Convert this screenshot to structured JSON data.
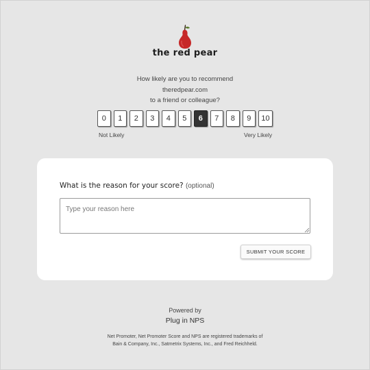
{
  "brand": {
    "logo_icon": "pear-icon",
    "name": "the red pear",
    "logo_color": "#c62828"
  },
  "survey": {
    "question_lines": [
      "How likely are you to recommend",
      "theredpear.com",
      "to a friend or colleague?"
    ],
    "scores": [
      "0",
      "1",
      "2",
      "3",
      "4",
      "5",
      "6",
      "7",
      "8",
      "9",
      "10"
    ],
    "selected_score": "6",
    "low_label": "Not Likely",
    "high_label": "Very Likely"
  },
  "reason": {
    "title": "What is the reason for your score?",
    "optional": "(optional)",
    "placeholder": "Type your reason here",
    "value": "",
    "submit_label": "SUBMIT YOUR SCORE"
  },
  "footer": {
    "powered_by": "Powered by",
    "provider": "Plug in NPS",
    "legal_lines": [
      "Net Promoter, Net Promoter Score and NPS are registered trademarks of",
      "Bain & Company, Inc., Satmetrix Systems, Inc., and Fred Reichheld."
    ]
  }
}
